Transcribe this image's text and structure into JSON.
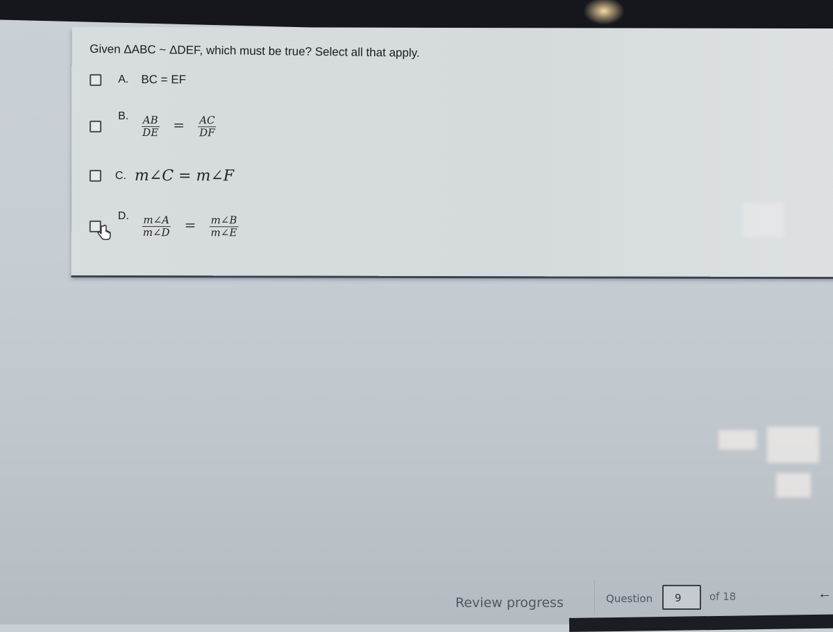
{
  "question": {
    "prompt": "Given ΔABC ~ ΔDEF, which must be true? Select all that apply.",
    "options": [
      {
        "letter": "A.",
        "text": "BC = EF",
        "checked": false
      },
      {
        "letter": "B.",
        "numerator_left": "AB",
        "denominator_left": "DE",
        "equals": "=",
        "numerator_right": "AC",
        "denominator_right": "DF",
        "checked": false
      },
      {
        "letter": "C.",
        "text": "m∠C = m∠F",
        "checked": false
      },
      {
        "letter": "D.",
        "numerator_left": "m∠A",
        "denominator_left": "m∠D",
        "equals": "=",
        "numerator_right": "m∠B",
        "denominator_right": "m∠E",
        "checked": false,
        "hovered": true
      }
    ]
  },
  "footer": {
    "review_label": "Review progress",
    "question_label": "Question",
    "question_number": "9",
    "of_label": "of 18",
    "back_icon": "arrow-left-icon"
  }
}
